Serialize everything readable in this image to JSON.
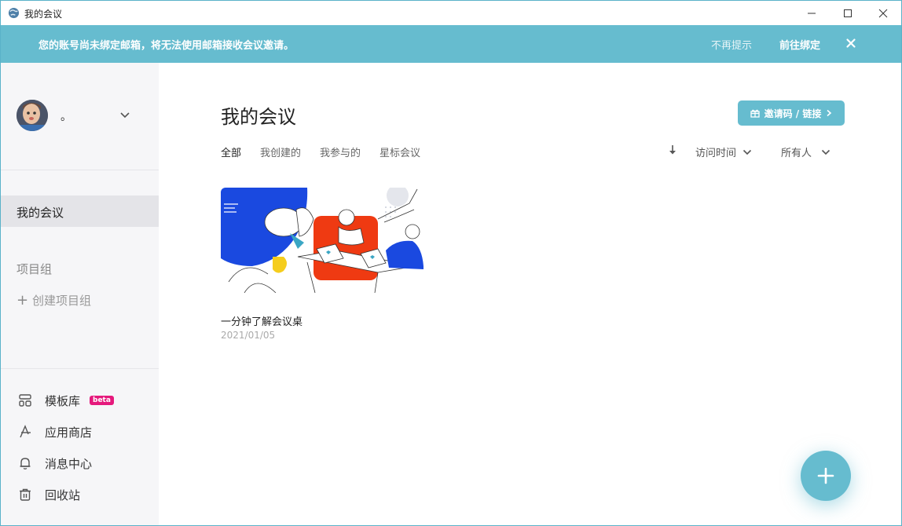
{
  "window": {
    "title": "我的会议",
    "icon": "globe-app-icon",
    "controls": [
      "minimize-icon",
      "maximize-icon",
      "close-icon"
    ]
  },
  "banner": {
    "message": "您的账号尚未绑定邮箱，将无法使用邮箱接收会议邀请。",
    "dismiss_label": "不再提示",
    "bind_label": "前往绑定",
    "bg_color": "#66bccf"
  },
  "sidebar": {
    "user": {
      "name": "。"
    },
    "active_item": "我的会议",
    "group_section_title": "项目组",
    "create_group_label": "创建项目组",
    "bottom_items": [
      {
        "label": "模板库",
        "icon": "template-icon",
        "badge": "beta"
      },
      {
        "label": "应用商店",
        "icon": "app-store-icon"
      },
      {
        "label": "消息中心",
        "icon": "bell-icon"
      },
      {
        "label": "回收站",
        "icon": "trash-icon"
      }
    ]
  },
  "main": {
    "title": "我的会议",
    "invite_button_label": "邀请码 / 链接",
    "tabs": [
      {
        "label": "全部",
        "active": true
      },
      {
        "label": "我创建的",
        "active": false
      },
      {
        "label": "我参与的",
        "active": false
      },
      {
        "label": "星标会议",
        "active": false
      }
    ],
    "sort_field": "访问时间",
    "owner_filter": "所有人",
    "meetings": [
      {
        "title": "一分钟了解会议桌",
        "date": "2021/01/05"
      }
    ]
  },
  "colors": {
    "accent": "#66bccf",
    "badge": "#e5197c",
    "illustration_blue": "#1a49e0",
    "illustration_red": "#ef3a12",
    "illustration_yellow": "#f5cd1d"
  }
}
